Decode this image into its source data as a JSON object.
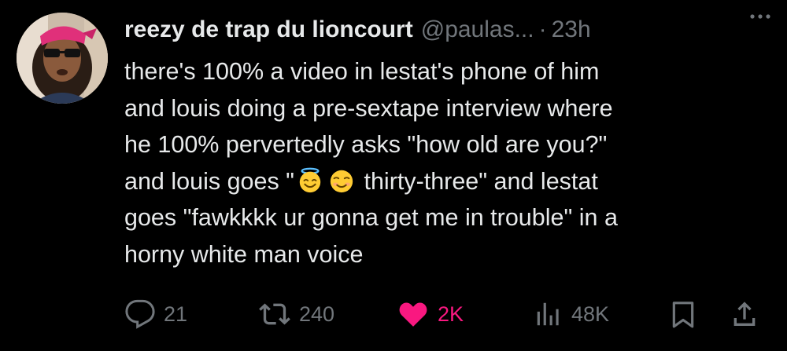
{
  "tweet": {
    "display_name": "reezy de trap du lioncourt",
    "handle": "@paulas...",
    "separator": "·",
    "time": "23h",
    "text_lines": [
      "there's 100% a video in lestat's phone of him",
      "and louis doing a pre-sextape interview where",
      "he 100% pervertedly asks \"how old are you?\"",
      {
        "before": "and louis goes \"",
        "emoji": [
          "smiling-face-with-halo",
          "smiling-face"
        ],
        "after": " thirty-three\" and lestat"
      },
      "goes \"fawkkkk ur gonna get me in trouble\" in a",
      "horny white man voice"
    ]
  },
  "actions": {
    "replies": "21",
    "reposts": "240",
    "likes": "2K",
    "views": "48K"
  },
  "colors": {
    "background": "#000000",
    "text": "#e7e9ea",
    "muted": "#71767b",
    "like": "#f91880",
    "emoji_yellow": "#ffcc33"
  },
  "icons": [
    "more-icon",
    "reply-icon",
    "repost-icon",
    "heart-icon",
    "views-icon",
    "bookmark-icon",
    "share-icon"
  ]
}
